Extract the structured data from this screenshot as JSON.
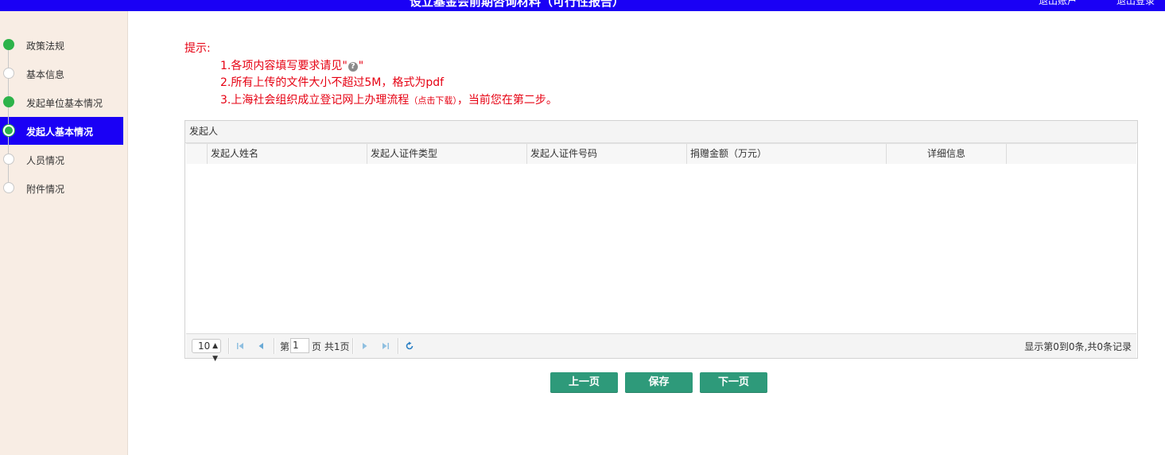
{
  "header": {
    "title": "设立基金会前期咨询材料（可行性报告）",
    "right_link_1": "退出账户",
    "right_link_2": "退出登录"
  },
  "sidebar": {
    "steps": [
      {
        "label": "政策法规",
        "state": "done"
      },
      {
        "label": "基本信息",
        "state": "todo"
      },
      {
        "label": "发起单位基本情况",
        "state": "done"
      },
      {
        "label": "发起人基本情况",
        "state": "active"
      },
      {
        "label": "人员情况",
        "state": "todo"
      },
      {
        "label": "附件情况",
        "state": "todo"
      }
    ]
  },
  "tips": {
    "head": "提示:",
    "line1_prefix": "1.各项内容填写要求请见\"",
    "line1_suffix": "\"",
    "line2": "2.所有上传的文件大小不超过5M，格式为pdf",
    "line3_prefix": "3.上海社会组织成立登记网上办理流程",
    "line3_link": "（点击下载）",
    "line3_suffix": "，当前您在第二步。"
  },
  "panel": {
    "title": "发起人",
    "columns": [
      "发起人姓名",
      "发起人证件类型",
      "发起人证件号码",
      "捐赠金额（万元）",
      "详细信息"
    ],
    "rows": []
  },
  "pager": {
    "page_size": "10",
    "page_prefix": "第",
    "page_value": "1",
    "page_suffix": "页 共1页",
    "info": "显示第0到0条,共0条记录"
  },
  "actions": {
    "prev": "上一页",
    "save": "保存",
    "next": "下一页"
  },
  "colors": {
    "primary_blue": "#1a00f5",
    "done_green": "#2db34a",
    "tip_red": "#e60012",
    "button_green": "#2e9a7a",
    "sidebar_bg": "#f8ede4"
  }
}
